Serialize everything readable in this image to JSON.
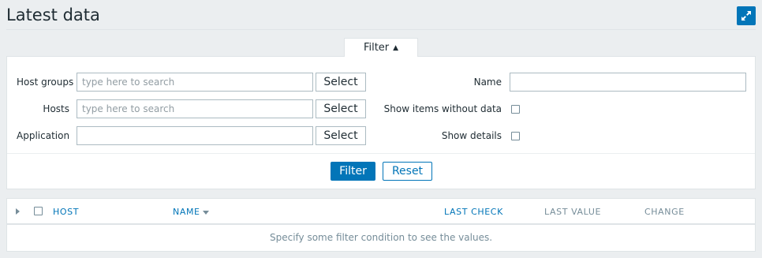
{
  "page": {
    "title": "Latest data"
  },
  "header": {
    "fullscreen_icon": "expand-arrows-icon",
    "accent": "#0275b8"
  },
  "filter": {
    "tab_label": "Filter",
    "tab_arrow": "▲",
    "host_groups": {
      "label": "Host groups",
      "placeholder": "type here to search",
      "value": "",
      "select_label": "Select"
    },
    "hosts": {
      "label": "Hosts",
      "placeholder": "type here to search",
      "value": "",
      "select_label": "Select"
    },
    "application": {
      "label": "Application",
      "value": "",
      "select_label": "Select"
    },
    "name": {
      "label": "Name",
      "value": ""
    },
    "show_items_without_data": {
      "label": "Show items without data",
      "checked": false
    },
    "show_details": {
      "label": "Show details",
      "checked": false
    },
    "apply_label": "Filter",
    "reset_label": "Reset"
  },
  "table": {
    "columns": [
      {
        "label": "HOST",
        "sortable": true
      },
      {
        "label": "NAME",
        "sortable": true,
        "sorted": "desc"
      },
      {
        "label": "LAST CHECK",
        "sortable": true
      },
      {
        "label": "LAST VALUE",
        "sortable": false
      },
      {
        "label": "CHANGE",
        "sortable": false
      }
    ],
    "empty_message": "Specify some filter condition to see the values."
  }
}
